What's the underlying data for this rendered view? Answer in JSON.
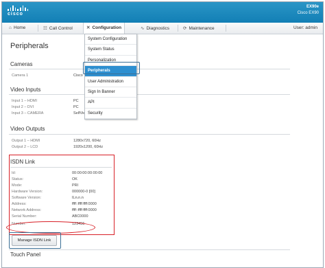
{
  "header": {
    "logo_text": "cisco",
    "device_model": "EX90e",
    "device_name": "Cisco EX90"
  },
  "nav": {
    "home": "Home",
    "call_control": "Call Control",
    "configuration": "Configuration",
    "diagnostics": "Diagnostics",
    "maintenance": "Maintenance",
    "user": "User: admin"
  },
  "menu": {
    "items": [
      "System Configuration",
      "System Status",
      "Personalization",
      "Peripherals",
      "User Administration",
      "Sign In Banner",
      "API",
      "Security"
    ],
    "selected": "Peripherals"
  },
  "page": {
    "title": "Peripherals",
    "cameras": {
      "heading": "Cameras",
      "rows": [
        {
          "label": "Camera 1",
          "value": "Cisco"
        }
      ]
    },
    "video_inputs": {
      "heading": "Video Inputs",
      "rows": [
        {
          "label": "Input 1 – HDMI",
          "value": "PC"
        },
        {
          "label": "Input 2 – DVI",
          "value": "PC"
        },
        {
          "label": "Input 3 – CAMERA",
          "value": "SelfView"
        }
      ]
    },
    "video_outputs": {
      "heading": "Video Outputs",
      "rows": [
        {
          "label": "Output 1 – HDMI",
          "value": "1280x720, 60Hz"
        },
        {
          "label": "Output 2 – LCD",
          "value": "1920x1200, 60Hz"
        }
      ]
    },
    "isdn_link": {
      "heading": "ISDN Link",
      "rows": [
        {
          "label": "Id:",
          "value": "00:00:00:00:00:00"
        },
        {
          "label": "Status:",
          "value": "OK"
        },
        {
          "label": "Mode:",
          "value": "PRI"
        },
        {
          "label": "Hardware Version:",
          "value": "000000-0 [00]"
        },
        {
          "label": "Software Version:",
          "value": "ILn.n.n"
        },
        {
          "label": "Address:",
          "value": "ffff::ffff:ffff:0000"
        },
        {
          "label": "Network Address:",
          "value": "ffff::ffff:ffff:0000"
        },
        {
          "label": "Serial Number:",
          "value": "ABC0000"
        },
        {
          "label": "Number:",
          "value": "123456"
        }
      ]
    },
    "manage_button": "Manage ISDN Link",
    "touch_panel": {
      "heading": "Touch Panel"
    }
  },
  "colors": {
    "header_blue": "#1a88bf",
    "highlight_red": "#d81f26",
    "menu_selected": "#2d8fd0",
    "callout_blue": "#3a6f96"
  }
}
